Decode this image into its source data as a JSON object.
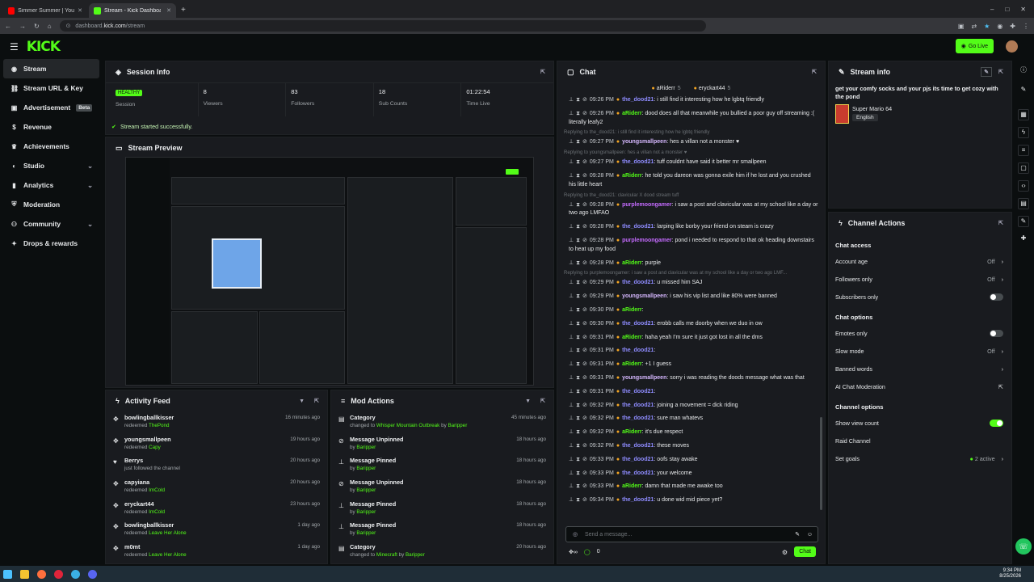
{
  "browser": {
    "tabs": [
      {
        "title": "Simmer Summer | YouTube",
        "fav_color": "#ff0000"
      },
      {
        "title": "Stream - Kick Dashboard",
        "fav_color": "#53fc18"
      }
    ],
    "url_prefix": "dashboard.",
    "url_host": "kick.com",
    "url_path": "/stream"
  },
  "topnav": {
    "logo": "KICK",
    "go_live": "Go Live"
  },
  "sidebar": {
    "items": [
      {
        "label": "Stream",
        "icon": "antenna-icon"
      },
      {
        "label": "Stream URL & Key",
        "icon": "link-icon"
      },
      {
        "label": "Advertisement",
        "icon": "ad-icon",
        "badge": "Beta"
      },
      {
        "label": "Revenue",
        "icon": "money-icon"
      },
      {
        "label": "Achievements",
        "icon": "trophy-icon"
      },
      {
        "label": "Studio",
        "icon": "studio-icon"
      },
      {
        "label": "Analytics",
        "icon": "chart-icon"
      },
      {
        "label": "Moderation",
        "icon": "shield-icon"
      },
      {
        "label": "Community",
        "icon": "people-icon"
      },
      {
        "label": "Drops & rewards",
        "icon": "gift-icon"
      }
    ]
  },
  "session": {
    "title": "Session Info",
    "healthy": "HEALTHY",
    "stats": [
      {
        "value": "",
        "label": "Session"
      },
      {
        "value": "8",
        "label": "Viewers"
      },
      {
        "value": "83",
        "label": "Followers"
      },
      {
        "value": "18",
        "label": "Sub Counts"
      },
      {
        "value": "01:22:54",
        "label": "Time Live"
      }
    ],
    "success": "Stream started successfully."
  },
  "preview": {
    "title": "Stream Preview"
  },
  "activity": {
    "title": "Activity Feed",
    "rows": [
      {
        "name": "bowlingballkisser",
        "pre": "redeemed ",
        "hl": "ThePond",
        "time": "16 minutes ago"
      },
      {
        "name": "youngsmallpeen",
        "pre": "redeemed ",
        "hl": "Capy",
        "time": "19 hours ago"
      },
      {
        "name": "Berrys",
        "pre": "just followed the channel",
        "hl": "",
        "time": "20 hours ago"
      },
      {
        "name": "capyiana",
        "pre": "redeemed ",
        "hl": "ImCold",
        "time": "20 hours ago"
      },
      {
        "name": "eryckart44",
        "pre": "redeemed ",
        "hl": "ImCold",
        "time": "23 hours ago"
      },
      {
        "name": "bowlingballkisser",
        "pre": "redeemed ",
        "hl": "Leave Her Alone",
        "time": "1 day ago"
      },
      {
        "name": "m0mt",
        "pre": "redeemed ",
        "hl": "Leave Her Alone",
        "time": "1 day ago"
      }
    ]
  },
  "mod": {
    "title": "Mod Actions",
    "rows": [
      {
        "name": "Category",
        "pre": "changed to ",
        "hl": "Whisper Mountain Outbreak",
        "by": " by ",
        "who": "Baripper",
        "time": "45 minutes ago"
      },
      {
        "name": "Message Unpinned",
        "pre": "",
        "hl": "",
        "by": "by ",
        "who": "Baripper",
        "time": "18 hours ago"
      },
      {
        "name": "Message Pinned",
        "pre": "",
        "hl": "",
        "by": "by ",
        "who": "Baripper",
        "time": "18 hours ago"
      },
      {
        "name": "Message Unpinned",
        "pre": "",
        "hl": "",
        "by": "by ",
        "who": "Baripper",
        "time": "18 hours ago"
      },
      {
        "name": "Message Pinned",
        "pre": "",
        "hl": "",
        "by": "by ",
        "who": "Baripper",
        "time": "18 hours ago"
      },
      {
        "name": "Message Pinned",
        "pre": "",
        "hl": "",
        "by": "by ",
        "who": "Baripper",
        "time": "18 hours ago"
      },
      {
        "name": "Category",
        "pre": "changed to ",
        "hl": "Minecraft",
        "by": " by ",
        "who": "Baripper",
        "time": "20 hours ago"
      }
    ]
  },
  "chat": {
    "title": "Chat",
    "top_users": [
      {
        "name": "aRiderr",
        "count": "5"
      },
      {
        "name": "eryckart44",
        "count": "5"
      }
    ],
    "messages": [
      {
        "time": "09:26 PM",
        "user": "the_dood21",
        "color": "#8f8cff",
        "text": "i still find it interesting how he lgbtq friendly"
      },
      {
        "time": "09:26 PM",
        "user": "aRiderr",
        "color": "#53fc18",
        "text": "dood does all that meanwhile you bullied a poor guy off streaming :( literally leafy2"
      },
      {
        "reply": "Replying to the_dood21: i still find it interesting how he lgbtq friendly"
      },
      {
        "time": "09:27 PM",
        "user": "youngsmallpeen",
        "color": "#d6b8ff",
        "text": "hes a villan not a monster ♥"
      },
      {
        "reply": "Replying to youngsmallpeen: hes a villan not a monster ♥"
      },
      {
        "time": "09:27 PM",
        "user": "the_dood21",
        "color": "#8f8cff",
        "text": "tuff couldnt have said it better mr smallpeen"
      },
      {
        "time": "09:28 PM",
        "user": "aRiderr",
        "color": "#53fc18",
        "text": "he told you dareon was gonna exile him if he lost and you crushed his little heart"
      },
      {
        "reply": "Replying to the_dood21: clavicular X dood stream tuff"
      },
      {
        "time": "09:28 PM",
        "user": "purplemoongamer",
        "color": "#c56bff",
        "text": "i saw a post and clavicular was at my school like a day or two ago LMFAO"
      },
      {
        "time": "09:28 PM",
        "user": "the_dood21",
        "color": "#8f8cff",
        "text": "larping like borby your friend on steam is crazy"
      },
      {
        "time": "09:28 PM",
        "user": "purplemoongamer",
        "color": "#c56bff",
        "text": "pond i needed to respond to that ok heading downstairs to heat up my food"
      },
      {
        "time": "09:28 PM",
        "user": "aRiderr",
        "color": "#53fc18",
        "text": "purple"
      },
      {
        "reply": "Replying to purplemoongamer: i saw a post and clavicular was at my school like a day or two ago LMF..."
      },
      {
        "time": "09:29 PM",
        "user": "the_dood21",
        "color": "#8f8cff",
        "text": "u missed him SAJ"
      },
      {
        "time": "09:29 PM",
        "user": "youngsmallpeen",
        "color": "#d6b8ff",
        "text": "i saw his vip list and like 80% were banned"
      },
      {
        "time": "09:30 PM",
        "user": "aRiderr",
        "color": "#53fc18",
        "text": ""
      },
      {
        "time": "09:30 PM",
        "user": "the_dood21",
        "color": "#8f8cff",
        "text": "erobb calls me doorby when we duo in ow"
      },
      {
        "time": "09:31 PM",
        "user": "aRiderr",
        "color": "#53fc18",
        "text": "haha yeah I'm sure it just got lost in all the dms"
      },
      {
        "time": "09:31 PM",
        "user": "the_dood21",
        "color": "#8f8cff",
        "text": ""
      },
      {
        "time": "09:31 PM",
        "user": "aRiderr",
        "color": "#53fc18",
        "text": "+1 I guess"
      },
      {
        "time": "09:31 PM",
        "user": "youngsmallpeen",
        "color": "#d6b8ff",
        "text": "sorry i was reading the doods message what was that"
      },
      {
        "time": "09:31 PM",
        "user": "the_dood21",
        "color": "#8f8cff",
        "text": ""
      },
      {
        "time": "09:32 PM",
        "user": "the_dood21",
        "color": "#8f8cff",
        "text": "joining a movement = dick riding"
      },
      {
        "time": "09:32 PM",
        "user": "the_dood21",
        "color": "#8f8cff",
        "text": "sure man whatevs"
      },
      {
        "time": "09:32 PM",
        "user": "aRiderr",
        "color": "#53fc18",
        "text": "it's due respect"
      },
      {
        "time": "09:32 PM",
        "user": "the_dood21",
        "color": "#8f8cff",
        "text": "these moves"
      },
      {
        "time": "09:33 PM",
        "user": "the_dood21",
        "color": "#8f8cff",
        "text": "oofs stay awake"
      },
      {
        "time": "09:33 PM",
        "user": "the_dood21",
        "color": "#8f8cff",
        "text": "your welcome"
      },
      {
        "time": "09:33 PM",
        "user": "aRiderr",
        "color": "#53fc18",
        "text": "damn that made me awake too"
      },
      {
        "time": "09:34 PM",
        "user": "the_dood21",
        "color": "#8f8cff",
        "text": "u done wid mid piece yet?"
      }
    ],
    "input_placeholder": "Send a message...",
    "points": "0",
    "send": "Chat"
  },
  "stream_info": {
    "title": "Stream info",
    "stream_title": "get your comfy socks and your pjs its time to get cozy with the pond",
    "category": "Super Mario 64",
    "language": "English"
  },
  "channel_actions": {
    "title": "Channel Actions",
    "sections": [
      {
        "heading": "Chat access",
        "rows": [
          {
            "label": "Account age",
            "value": "Off",
            "kind": "chevron"
          },
          {
            "label": "Followers only",
            "value": "Off",
            "kind": "chevron"
          },
          {
            "label": "Subscribers only",
            "value": "",
            "kind": "toggle-off"
          }
        ]
      },
      {
        "heading": "Chat options",
        "rows": [
          {
            "label": "Emotes only",
            "value": "",
            "kind": "toggle-off"
          },
          {
            "label": "Slow mode",
            "value": "Off",
            "kind": "chevron"
          },
          {
            "label": "Banned words",
            "value": "",
            "kind": "chevron"
          },
          {
            "label": "AI Chat Moderation",
            "value": "",
            "kind": "external"
          }
        ]
      },
      {
        "heading": "Channel options",
        "rows": [
          {
            "label": "Show view count",
            "value": "",
            "kind": "toggle-on"
          },
          {
            "label": "Raid Channel",
            "value": "",
            "kind": "none"
          },
          {
            "label": "Set goals",
            "value": "2 active",
            "kind": "chevron"
          }
        ]
      }
    ]
  },
  "taskbar": {
    "time": "9:34 PM",
    "date": "8/25/2026"
  }
}
